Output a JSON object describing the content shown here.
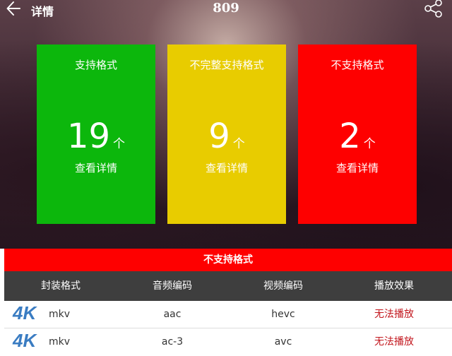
{
  "header": {
    "back_icon": "arrow-left-icon",
    "title": "详情",
    "center_title": "809",
    "share_icon": "share-icon"
  },
  "cards": [
    {
      "title": "支持格式",
      "count": "19",
      "unit": "个",
      "link": "查看详情",
      "color": "#0cb70c"
    },
    {
      "title": "不完整支持格式",
      "count": "9",
      "unit": "个",
      "link": "查看详情",
      "color": "#e8cc00"
    },
    {
      "title": "不支持格式",
      "count": "2",
      "unit": "个",
      "link": "查看详情",
      "color": "#fe0000"
    }
  ],
  "panel": {
    "title": "不支持格式",
    "columns": [
      "封装格式",
      "音频编码",
      "视频编码",
      "播放效果"
    ],
    "rows": [
      {
        "badge": "4K",
        "container": "mkv",
        "audio": "aac",
        "video": "hevc",
        "effect": "无法播放"
      },
      {
        "badge": "4K",
        "container": "mkv",
        "audio": "ac-3",
        "video": "avc",
        "effect": "无法播放"
      }
    ]
  },
  "colors": {
    "accent_red": "#fe0000",
    "effect_red": "#c2151c",
    "header_dark": "#3e3e3e",
    "badge_blue": "#3a7cc2"
  }
}
